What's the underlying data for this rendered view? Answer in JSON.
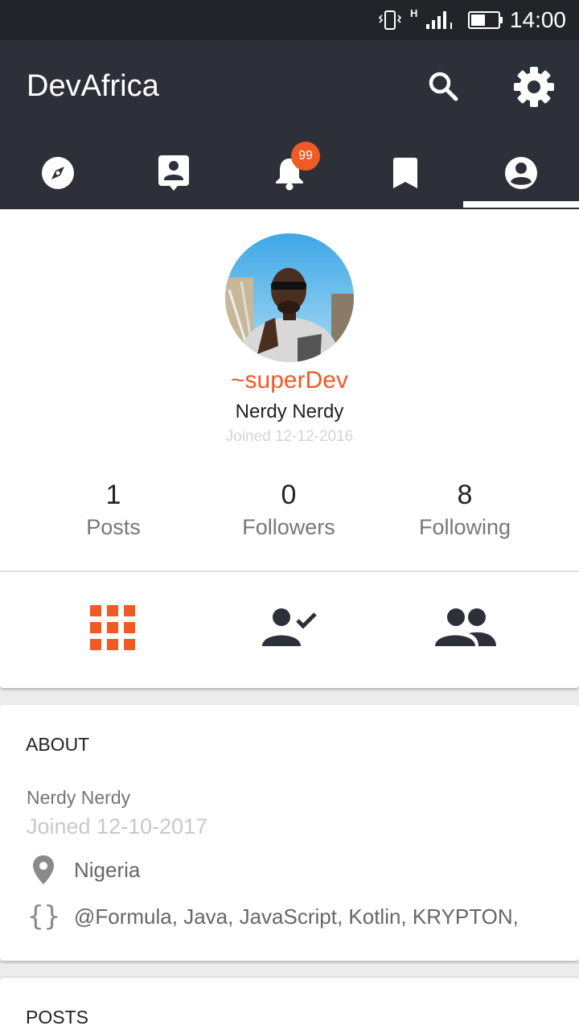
{
  "status_bar": {
    "time": "14:00",
    "network_label": "H",
    "icons": [
      "vibrate-icon",
      "signal-icon",
      "battery-icon"
    ]
  },
  "app_bar": {
    "title": "DevAfrica",
    "actions": [
      "search-icon",
      "settings-gear-icon"
    ]
  },
  "tabs": [
    {
      "name": "explore",
      "icon": "compass-icon"
    },
    {
      "name": "contacts",
      "icon": "contact-card-icon"
    },
    {
      "name": "notifications",
      "icon": "bell-icon",
      "badge": "99"
    },
    {
      "name": "bookmarks",
      "icon": "bookmark-icon"
    },
    {
      "name": "profile",
      "icon": "account-circle-icon",
      "selected": true
    }
  ],
  "profile": {
    "username": "~superDev",
    "full_name": "Nerdy Nerdy",
    "joined": "Joined 12-12-2016",
    "stats": [
      {
        "value": "1",
        "label": "Posts"
      },
      {
        "value": "0",
        "label": "Followers"
      },
      {
        "value": "8",
        "label": "Following"
      }
    ],
    "view_buttons": [
      "grid-icon",
      "person-check-icon",
      "people-icon"
    ]
  },
  "about": {
    "title": "ABOUT",
    "name": "Nerdy Nerdy",
    "joined": "Joined 12-10-2017",
    "location": "Nigeria",
    "skills": "@Formula, Java, JavaScript, Kotlin, KRYPTON,"
  },
  "posts": {
    "title": "POSTS"
  },
  "colors": {
    "accent": "#f05a24",
    "app_bar": "#2e3039",
    "status_bar": "#222429",
    "icon_dark": "#2e3039"
  }
}
